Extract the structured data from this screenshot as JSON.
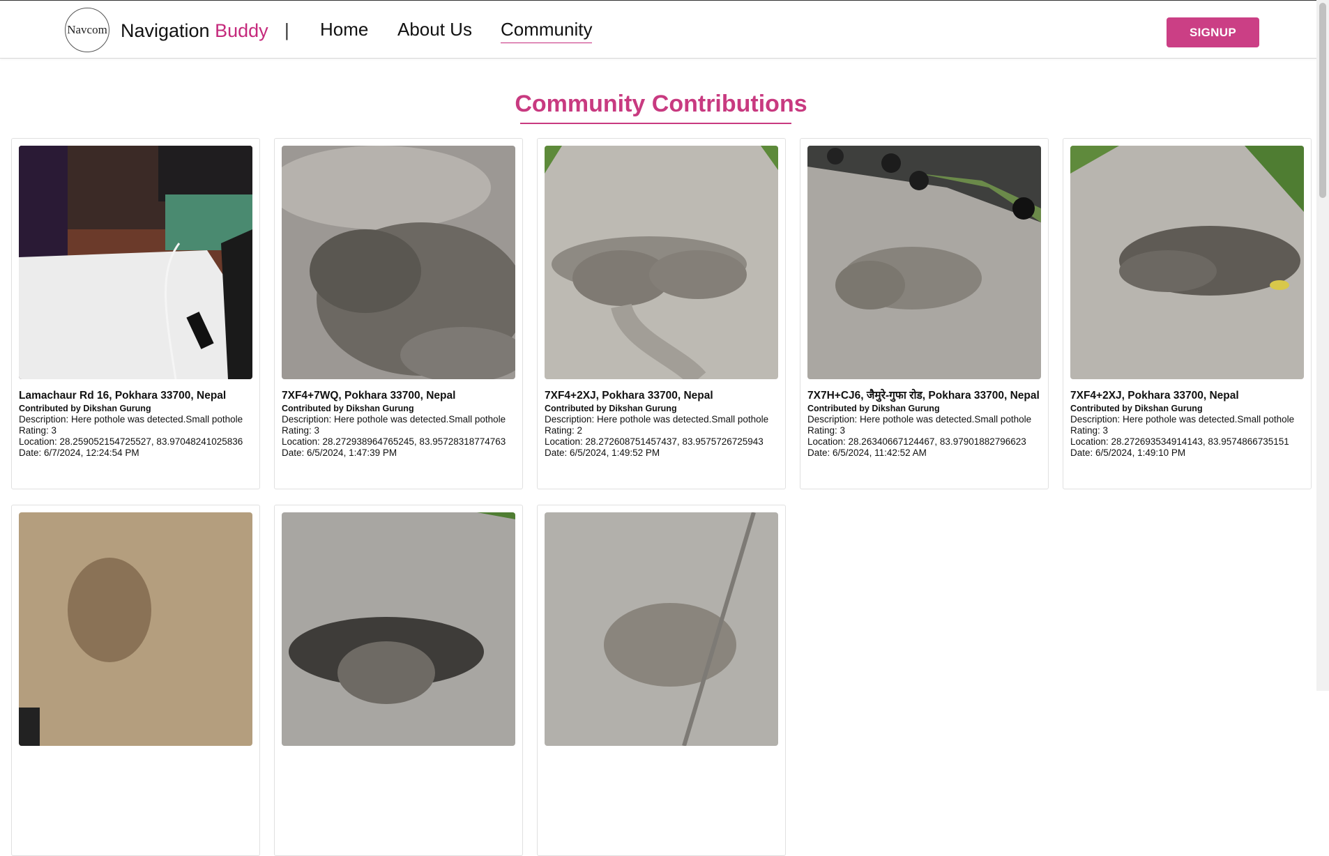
{
  "header": {
    "logo_text": "Navcom",
    "brand_main": "Navigation ",
    "brand_accent": "Buddy",
    "separator": "|",
    "nav": [
      "Home",
      "About Us",
      "Community"
    ],
    "signup_label": "SIGNUP"
  },
  "colors": {
    "accent": "#c83a80",
    "button": "#cb3f85"
  },
  "main": {
    "title": "Community Contributions",
    "cards": [
      {
        "title": "Lamachaur Rd 16, Pokhara 33700, Nepal",
        "contributor": "Contributed by Dikshan Gurung",
        "description": "Description: Here pothole was detected.Small pothole",
        "rating": "Rating: 3",
        "location": "Location: 28.259052154725527, 83.97048241025836",
        "date": "Date: 6/7/2024, 12:24:54 PM",
        "image": "desk with laptop and cable"
      },
      {
        "title": "7XF4+7WQ, Pokhara 33700, Nepal",
        "contributor": "Contributed by Dikshan Gurung",
        "description": "Description: Here pothole was detected.Small pothole",
        "rating": "Rating: 3",
        "location": "Location: 28.272938964765245, 83.95728318774763",
        "date": "Date: 6/5/2024, 1:47:39 PM",
        "image": "shaded road pothole"
      },
      {
        "title": "7XF4+2XJ, Pokhara 33700, Nepal",
        "contributor": "Contributed by Dikshan Gurung",
        "description": "Description: Here pothole was detected.Small pothole",
        "rating": "Rating: 2",
        "location": "Location: 28.272608751457437, 83.9575726725943",
        "date": "Date: 6/5/2024, 1:49:52 PM",
        "image": "road with large pothole"
      },
      {
        "title": "7X7H+CJ6, जैमुरे-गुफा रोड, Pokhara 33700, Nepal",
        "contributor": "Contributed by Dikshan Gurung",
        "description": "Description: Here pothole was detected.Small pothole",
        "rating": "Rating: 3",
        "location": "Location: 28.26340667124467, 83.97901882796623",
        "date": "Date: 6/5/2024, 11:42:52 AM",
        "image": "road pothole near motorbikes"
      },
      {
        "title": "7XF4+2XJ, Pokhara 33700, Nepal",
        "contributor": "Contributed by Dikshan Gurung",
        "description": "Description: Here pothole was detected.Small pothole",
        "rating": "Rating: 3",
        "location": "Location: 28.272693534914143, 83.9574866735151",
        "date": "Date: 6/5/2024, 1:49:10 PM",
        "image": "road with wet pothole"
      },
      {
        "title": "",
        "contributor": "",
        "description": "",
        "rating": "",
        "location": "",
        "date": "",
        "image": "dirt pothole"
      },
      {
        "title": "",
        "contributor": "",
        "description": "",
        "rating": "",
        "location": "",
        "date": "",
        "image": "gravel road pothole"
      },
      {
        "title": "",
        "contributor": "",
        "description": "",
        "rating": "",
        "location": "",
        "date": "",
        "image": "road pothole with shadow"
      }
    ]
  }
}
